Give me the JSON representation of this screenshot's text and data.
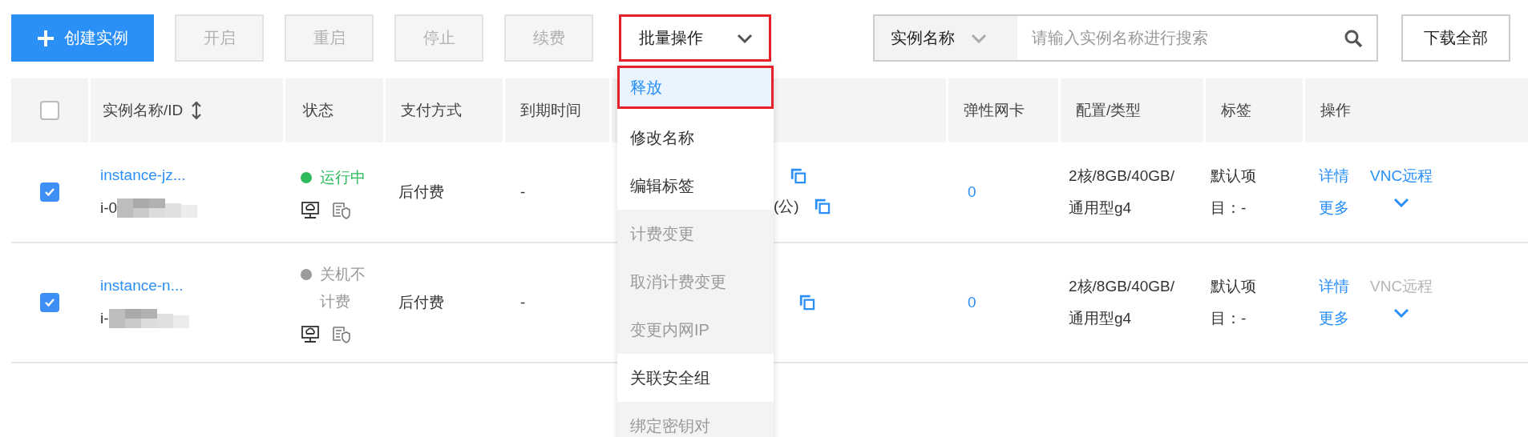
{
  "toolbar": {
    "buttons": [
      {
        "label": "创建实例",
        "kind": "primary",
        "disabled": false
      },
      {
        "label": "开启",
        "kind": "plain",
        "disabled": true
      },
      {
        "label": "重启",
        "kind": "plain",
        "disabled": true
      },
      {
        "label": "停止",
        "kind": "plain",
        "disabled": true
      },
      {
        "label": "续费",
        "kind": "plain",
        "disabled": true
      }
    ],
    "batch": {
      "label": "批量操作",
      "marked": true
    },
    "search": {
      "field": "实例名称",
      "placeholder": "请输入实例名称进行搜索"
    },
    "download": "下载全部"
  },
  "table": {
    "select_all_checked": false,
    "columns": [
      {
        "label": "实例名称/ID",
        "sortable": true
      },
      {
        "label": "状态",
        "sortable": false
      },
      {
        "label": "支付方式",
        "sortable": false
      },
      {
        "label": "到期时间",
        "sortable": false
      },
      {
        "label": "弹性网卡",
        "sortable": false
      },
      {
        "label": "配置/类型",
        "sortable": false
      },
      {
        "label": "标签",
        "sortable": false
      },
      {
        "label": "操作",
        "sortable": false
      }
    ],
    "rows": [
      {
        "checked": true,
        "name": "instance-jz...",
        "id": "i-0",
        "status": {
          "text": "运行中",
          "color": "#2dbb5c"
        },
        "ip_note": "(公)",
        "payment": "后付费",
        "expire": "-",
        "nic": "0",
        "config": "2核/8GB/40GB/通用型g4",
        "tags": "默认项目：-",
        "actions": {
          "detail": "详情",
          "vnc": "VNC远程",
          "vnc_disabled": false,
          "more": "更多"
        }
      },
      {
        "checked": true,
        "name": "instance-n...",
        "id": "i-",
        "status": {
          "text": "关机不计费",
          "color": "#9b9b9b"
        },
        "payment": "后付费",
        "expire": "-",
        "nic": "0",
        "config": "2核/8GB/40GB/通用型g4",
        "tags": "默认项目：-",
        "actions": {
          "detail": "详情",
          "vnc": "VNC远程",
          "vnc_disabled": true,
          "more": "更多"
        }
      }
    ]
  },
  "batch_menu": [
    {
      "label": "释放",
      "selected": true,
      "disabled": false,
      "marked": true
    },
    {
      "label": "修改名称",
      "selected": false,
      "disabled": false,
      "marked": false
    },
    {
      "label": "编辑标签",
      "selected": false,
      "disabled": false,
      "marked": false
    },
    {
      "label": "计费变更",
      "selected": false,
      "disabled": true,
      "marked": false
    },
    {
      "label": "取消计费变更",
      "selected": false,
      "disabled": true,
      "marked": false
    },
    {
      "label": "变更内网IP",
      "selected": false,
      "disabled": true,
      "marked": false
    },
    {
      "label": "关联安全组",
      "selected": false,
      "disabled": false,
      "marked": false
    },
    {
      "label": "绑定密钥对",
      "selected": false,
      "disabled": true,
      "marked": false
    }
  ]
}
